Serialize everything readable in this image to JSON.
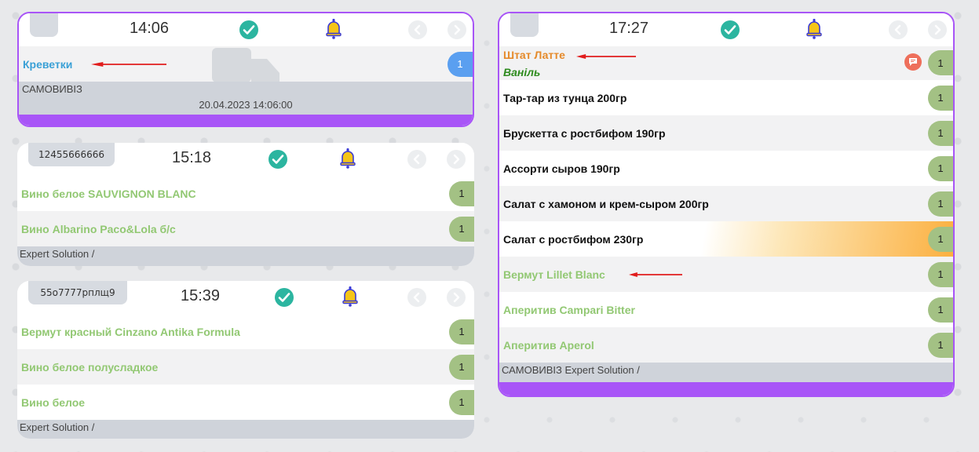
{
  "cards": [
    {
      "time": "14:06",
      "items": [
        {
          "name": "Креветки",
          "qty": "1"
        }
      ],
      "footer_type": "САМОВИВІЗ",
      "footer_date": "20.04.2023 14:06:00"
    },
    {
      "order_no": "12455666666",
      "time": "15:18",
      "items": [
        {
          "name": "Вино белое SAUVIGNON BLANC",
          "qty": "1"
        },
        {
          "name": "Вино Albarino Paco&Lola б/с",
          "qty": "1"
        }
      ],
      "footer": "Expert Solution /"
    },
    {
      "order_no": "55о7777рплщ9",
      "time": "15:39",
      "items": [
        {
          "name": "Вермут красный Cinzano Antika Formula",
          "qty": "1"
        },
        {
          "name": "Вино белое полусладкое",
          "qty": "1"
        },
        {
          "name": "Вино белое",
          "qty": "1"
        }
      ],
      "footer": "Expert Solution /"
    },
    {
      "time": "17:27",
      "items": [
        {
          "name": "Штат Латте",
          "modifier": "Ваніль",
          "qty": "1"
        },
        {
          "name": "Тар-тар из тунца 200гр",
          "qty": "1"
        },
        {
          "name": "Брускетта с ростбифом 190гр",
          "qty": "1"
        },
        {
          "name": "Ассорти сыров 190гр",
          "qty": "1"
        },
        {
          "name": "Салат с хамоном и крем-сыром 200гр",
          "qty": "1"
        },
        {
          "name": "Салат с ростбифом 230гр",
          "qty": "1"
        },
        {
          "name": "Вермут Lillet Blanc",
          "qty": "1"
        },
        {
          "name": "Аперитив Campari Bitter",
          "qty": "1"
        },
        {
          "name": "Аперитив Aperol",
          "qty": "1"
        }
      ],
      "footer": "САМОВИВІЗ Expert Solution /"
    }
  ],
  "colors": {
    "accent": "#a855f7",
    "check": "#2cb5a0",
    "qty": "#a3c184",
    "qty_blue": "#5a9ff0",
    "arrow": "#e11d1d",
    "bell": "#f5c518",
    "highlight": "#fbb040"
  },
  "icons": [
    "check-icon",
    "bell-icon",
    "chevron-left-icon",
    "chevron-right-icon",
    "comment-icon",
    "delivery-truck-icon",
    "red-arrow-icon"
  ]
}
